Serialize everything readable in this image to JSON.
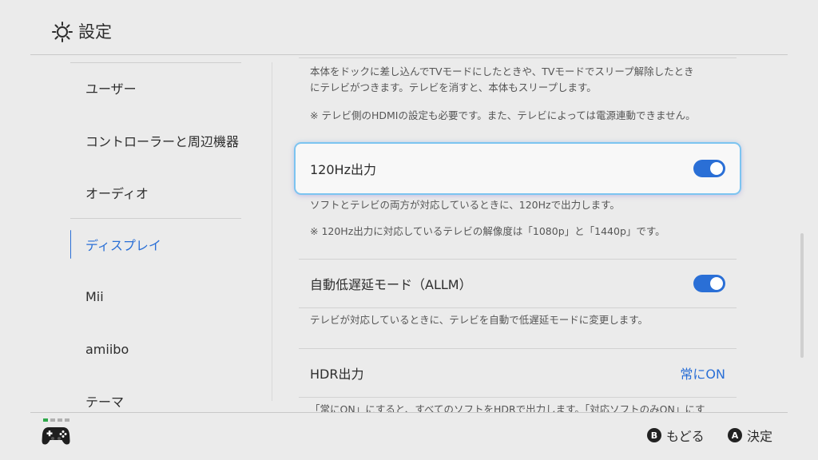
{
  "header": {
    "title": "設定",
    "icon": "gear-icon"
  },
  "sidebar": {
    "items": [
      {
        "label": "ユーザー"
      },
      {
        "label": "コントローラーと周辺機器"
      },
      {
        "label": "オーディオ"
      },
      {
        "label": "ディスプレイ",
        "active": true
      },
      {
        "label": "Mii"
      },
      {
        "label": "amiibo"
      },
      {
        "label": "テーマ"
      }
    ]
  },
  "content": {
    "top_desc_1": "本体をドックに差し込んでTVモードにしたときや、TVモードでスリープ解除したとき",
    "top_desc_2": "にテレビがつきます。テレビを消すと、本体もスリープします。",
    "top_note": "※ テレビ側のHDMIの設定も必要です。また、テレビによっては電源連動できません。",
    "hz120": {
      "label": "120Hz出力",
      "on": true,
      "desc": "ソフトとテレビの両方が対応しているときに、120Hzで出力します。",
      "note": "※ 120Hz出力に対応しているテレビの解像度は「1080p」と「1440p」です。"
    },
    "allm": {
      "label": "自動低遅延モード（ALLM）",
      "on": true,
      "desc": "テレビが対応しているときに、テレビを自動で低遅延モードに変更します。"
    },
    "hdr": {
      "label": "HDR出力",
      "value": "常にON",
      "desc": "「常にON」にすると、すべてのソフトをHDRで出力します。「対応ソフトのみON」にす"
    }
  },
  "footer": {
    "back_glyph": "B",
    "back_label": "もどる",
    "ok_glyph": "A",
    "ok_label": "決定",
    "player_indicator": [
      true,
      false,
      false,
      false
    ]
  },
  "colors": {
    "accent": "#2a6fd6",
    "background": "#ebebeb",
    "player_led": "#2ea84a"
  }
}
